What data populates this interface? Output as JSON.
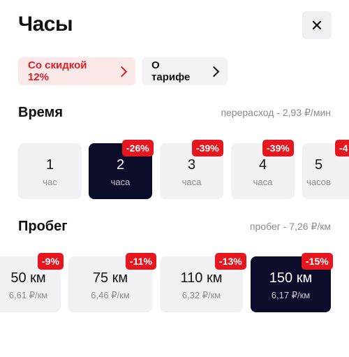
{
  "title": "Часы",
  "chips": {
    "discount": "Со скидкой 12%",
    "tariff": "О тарифе"
  },
  "time_section": {
    "title": "Время",
    "note": "перерасход - 2,93 ₽/мин",
    "options": [
      {
        "value": "1",
        "unit": "час",
        "badge": "",
        "selected": false
      },
      {
        "value": "2",
        "unit": "часа",
        "badge": "-26%",
        "selected": true
      },
      {
        "value": "3",
        "unit": "часа",
        "badge": "-39%",
        "selected": false
      },
      {
        "value": "4",
        "unit": "часа",
        "badge": "-39%",
        "selected": false
      },
      {
        "value": "5",
        "unit": "часов",
        "badge": "-4",
        "selected": false
      }
    ]
  },
  "mileage_section": {
    "title": "Пробег",
    "note": "пробег - 7,26 ₽/км",
    "options": [
      {
        "value": "50 км",
        "rate": "6,61 ₽/км",
        "badge": "-9%",
        "selected": false
      },
      {
        "value": "75 км",
        "rate": "6,46 ₽/км",
        "badge": "-11%",
        "selected": false
      },
      {
        "value": "110 км",
        "rate": "6,32 ₽/км",
        "badge": "-13%",
        "selected": false
      },
      {
        "value": "150 км",
        "rate": "6,17 ₽/км",
        "badge": "-15%",
        "selected": true
      }
    ]
  },
  "icons": {
    "close": "close-icon",
    "chevron": "chevron-right-icon"
  },
  "colors": {
    "accent": "#e5161e",
    "selected_bg": "#0b0b2a",
    "card_bg": "#f1f1f4"
  }
}
